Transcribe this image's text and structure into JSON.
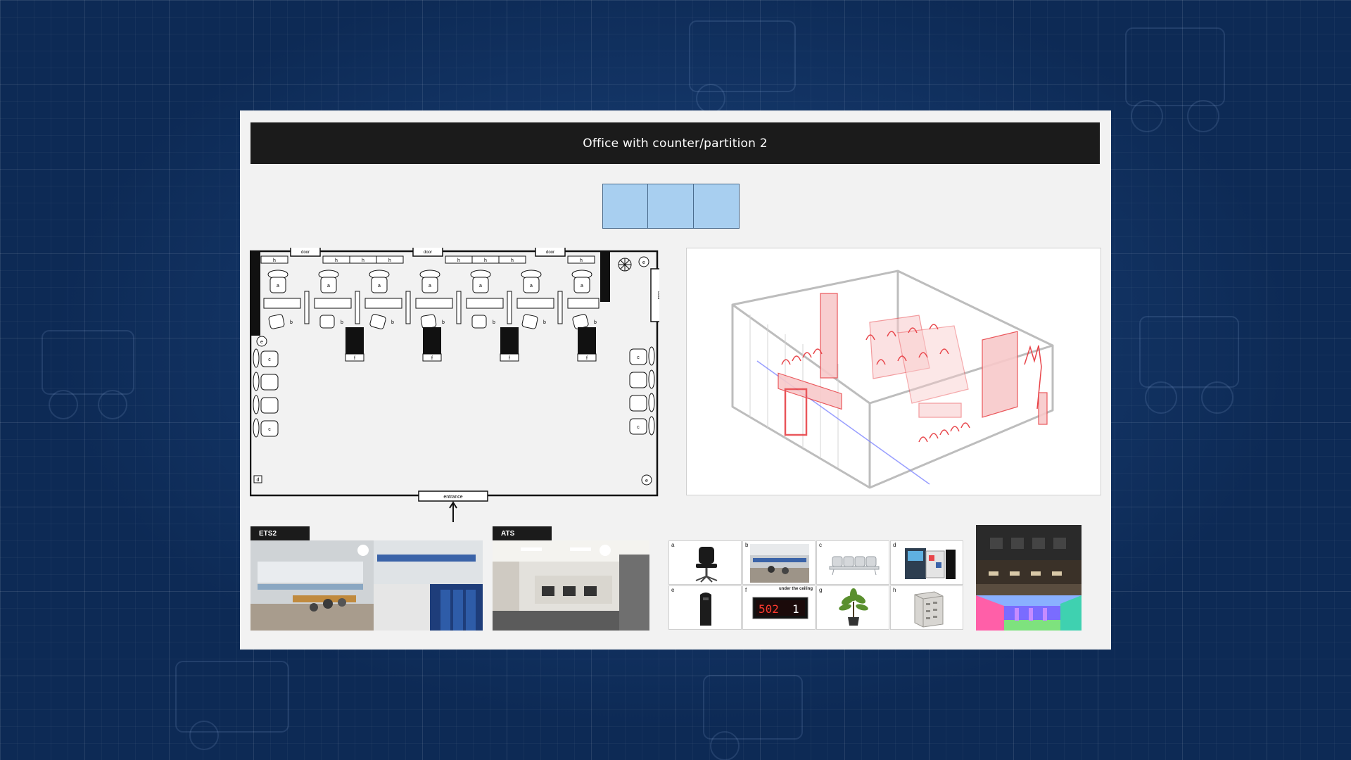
{
  "slide": {
    "title": "Office with counter/partition 2"
  },
  "palette": {
    "swatch_color": "#a8cff0",
    "accent_red": "#e8454a"
  },
  "floorplan": {
    "door_label": "door",
    "entrance_label": "entrance",
    "labels": {
      "a": "a",
      "b": "b",
      "c": "c",
      "d": "d",
      "e": "e",
      "f": "f",
      "h": "h"
    }
  },
  "reference_photos": [
    {
      "label": "ETS2"
    },
    {
      "label": "ATS"
    }
  ],
  "props": [
    {
      "letter": "a",
      "icon": "office-chair-icon"
    },
    {
      "letter": "b",
      "icon": "office-photo-icon"
    },
    {
      "letter": "c",
      "icon": "waiting-bench-icon"
    },
    {
      "letter": "d",
      "icon": "kiosk-icon"
    },
    {
      "letter": "e",
      "icon": "trash-bin-icon"
    },
    {
      "letter": "f",
      "icon": "queue-display-icon",
      "note": "under the ceiling",
      "display_left": "502",
      "display_right": "1"
    },
    {
      "letter": "g",
      "icon": "potted-plant-icon"
    },
    {
      "letter": "h",
      "icon": "cabinet-icon"
    }
  ]
}
